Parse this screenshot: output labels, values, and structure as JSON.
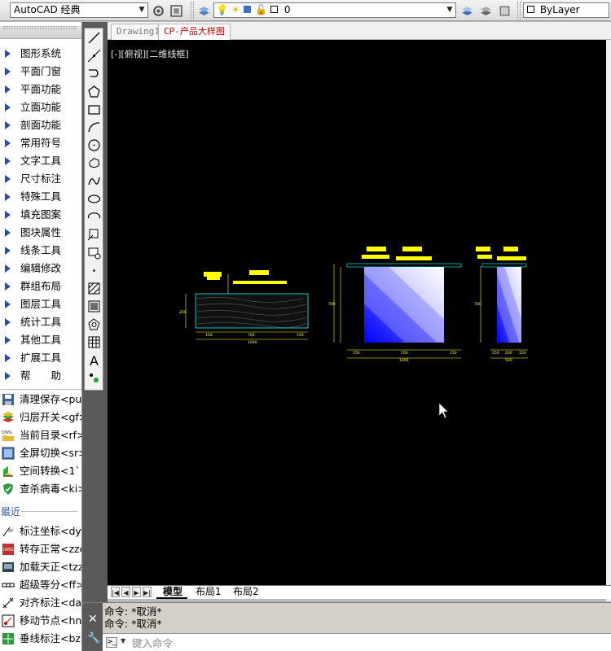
{
  "toolbar": {
    "workspace": "AutoCAD 经典",
    "layer": "0",
    "linetype": "ByLayer"
  },
  "left_menu": {
    "items": [
      {
        "label": "图形系统"
      },
      {
        "label": "平面门窗"
      },
      {
        "label": "平面功能"
      },
      {
        "label": "立面功能"
      },
      {
        "label": "剖面功能"
      },
      {
        "label": "常用符号"
      },
      {
        "label": "文字工具"
      },
      {
        "label": "尺寸标注"
      },
      {
        "label": "特殊工具"
      },
      {
        "label": "填充图案"
      },
      {
        "label": "图块属性"
      },
      {
        "label": "线条工具"
      },
      {
        "label": "编辑修改"
      },
      {
        "label": "群组布局"
      },
      {
        "label": "图层工具"
      },
      {
        "label": "统计工具"
      },
      {
        "label": "其他工具"
      },
      {
        "label": "扩展工具"
      },
      {
        "label": "帮　　助"
      }
    ],
    "commands": [
      {
        "label": "清理保存<pu>",
        "icon": "save-icon"
      },
      {
        "label": "归层开关<gf>",
        "icon": "layers-icon"
      },
      {
        "label": "当前目录<rf>",
        "icon": "dwg-folder-icon"
      },
      {
        "label": "全屏切换<sr>",
        "icon": "fullscreen-icon"
      },
      {
        "label": "空间转换<1`>",
        "icon": "space-convert-icon"
      },
      {
        "label": "查杀病毒<ki>",
        "icon": "shield-icon"
      }
    ],
    "recent_label": "最近",
    "recent": [
      {
        "label": "标注坐标<dy>",
        "icon": "coordinate-icon"
      },
      {
        "label": "转存正常<zzc>",
        "icon": "dwg-convert-icon"
      },
      {
        "label": "加载天正<tzz>",
        "icon": "load-icon"
      },
      {
        "label": "超级等分<ff>",
        "icon": "divide-icon"
      },
      {
        "label": "对齐标注<da>",
        "icon": "align-dim-icon"
      },
      {
        "label": "移动节点<hnn",
        "icon": "move-node-icon"
      },
      {
        "label": "垂线标注<bz>",
        "icon": "perp-dim-icon"
      }
    ]
  },
  "doc_tabs": [
    {
      "label": "Drawing1",
      "active": false
    },
    {
      "label": "CP-产品大样图",
      "active": true
    }
  ],
  "viewport_label": "[-][俯视][二维线框]",
  "layout_tabs": [
    {
      "label": "模型",
      "active": true
    },
    {
      "label": "布局1",
      "active": false
    },
    {
      "label": "布局2",
      "active": false
    }
  ],
  "command_history": [
    "命令: *取消*",
    "命令: *取消*"
  ],
  "command_input": {
    "placeholder": "键入命令",
    "value": ""
  },
  "drawing": {
    "dims_left": [
      "150",
      "700",
      "150",
      "1000",
      "200"
    ],
    "dims_mid": [
      "150",
      "700",
      "150",
      "1000",
      "700"
    ],
    "dims_right": [
      "150",
      "200",
      "150",
      "500",
      "700"
    ]
  }
}
